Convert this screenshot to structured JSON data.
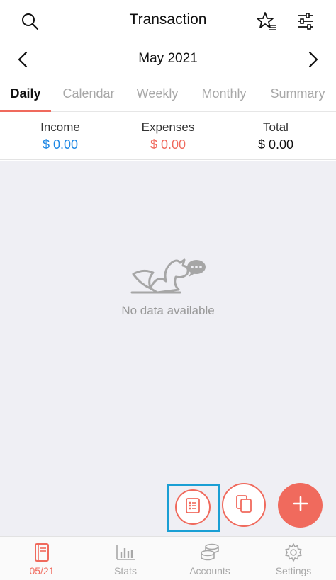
{
  "header": {
    "title": "Transaction",
    "icons": [
      "search-icon",
      "star-list-icon",
      "filter-sliders-icon"
    ]
  },
  "month_nav": {
    "label": "May 2021",
    "icons": [
      "chevron-left-icon",
      "chevron-right-icon"
    ]
  },
  "tabs": [
    {
      "label": "Daily",
      "active": true
    },
    {
      "label": "Calendar",
      "active": false
    },
    {
      "label": "Weekly",
      "active": false
    },
    {
      "label": "Monthly",
      "active": false
    },
    {
      "label": "Summary",
      "active": false
    }
  ],
  "summary": {
    "income": {
      "label": "Income",
      "value": "$ 0.00",
      "color": "#1e88e5"
    },
    "expenses": {
      "label": "Expenses",
      "value": "$ 0.00",
      "color": "#f06a5d"
    },
    "total": {
      "label": "Total",
      "value": "$ 0.00",
      "color": "#111111"
    }
  },
  "empty_state": {
    "message": "No data available",
    "icon": "dragon-mascot-icon"
  },
  "fabs": {
    "icons": [
      "list-icon",
      "copy-icon",
      "plus-icon"
    ]
  },
  "bottom_nav": [
    {
      "label": "05/21",
      "icon": "book-icon",
      "active": true
    },
    {
      "label": "Stats",
      "icon": "bar-chart-icon",
      "active": false
    },
    {
      "label": "Accounts",
      "icon": "coins-icon",
      "active": false
    },
    {
      "label": "Settings",
      "icon": "gear-icon",
      "active": false
    }
  ],
  "colors": {
    "accent": "#f06a5d",
    "income": "#1e88e5",
    "highlight": "#1a9fd4",
    "background": "#efeff4"
  }
}
